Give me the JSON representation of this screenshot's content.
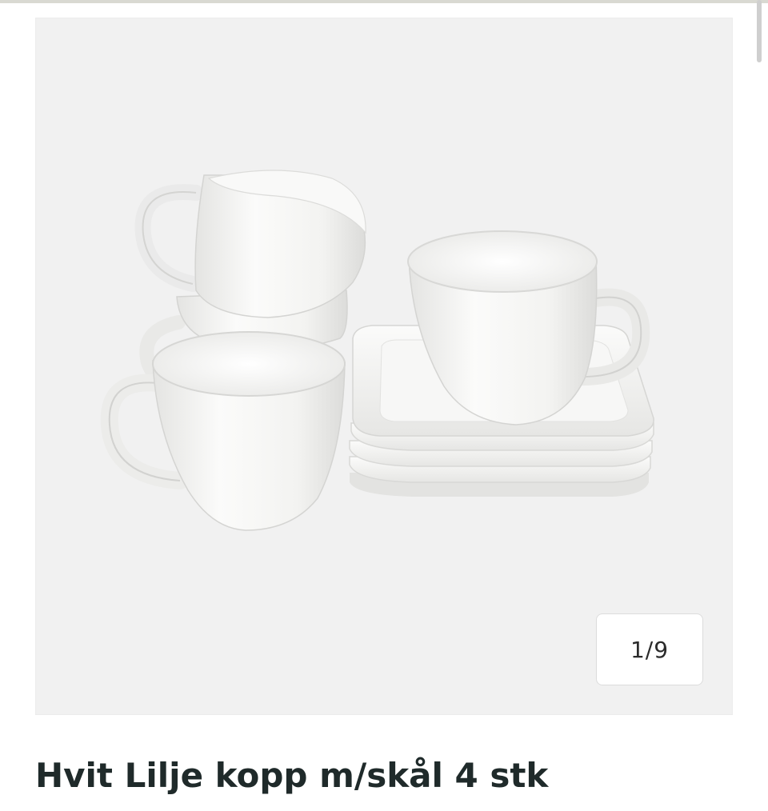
{
  "gallery": {
    "counter": "1/9",
    "image_subject": "white porcelain cups with square saucers"
  },
  "product": {
    "title": "Hvit Lilje kopp m/skål 4 stk"
  }
}
